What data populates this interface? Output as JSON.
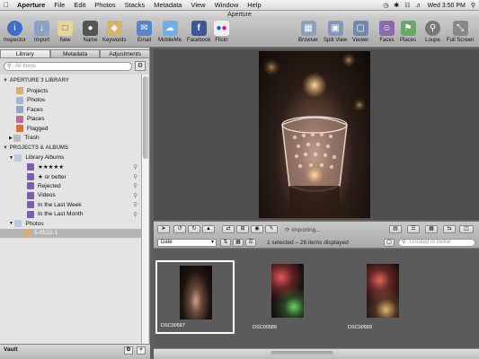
{
  "menubar": {
    "apple_icon": "apple-logo-icon",
    "items": [
      "Aperture",
      "File",
      "Edit",
      "Photos",
      "Stacks",
      "Metadata",
      "View",
      "Window",
      "Help"
    ],
    "clock": "Wed 3:50 PM"
  },
  "window": {
    "title": "Aperture"
  },
  "toolbar": {
    "inspector": "Inspector",
    "import": "Import",
    "new": "New",
    "name": "Name",
    "keywords": "Keywords",
    "email": "Email",
    "mobileme": "MobileMe",
    "facebook": "Facebook",
    "flickr": "Flickr",
    "browser": "Browser",
    "split_view": "Split View",
    "viewer": "Viewer",
    "faces": "Faces",
    "places": "Places",
    "loupe": "Loupe",
    "full_screen": "Full Screen"
  },
  "sidebar": {
    "tabs": [
      "Library",
      "Metadata",
      "Adjustments"
    ],
    "search_placeholder": "All Items",
    "library_header": "APERTURE 3 LIBRARY",
    "library_items": [
      "Projects",
      "Photos",
      "Faces",
      "Places",
      "Flagged",
      "Trash"
    ],
    "projects_header": "PROJECTS & ALBUMS",
    "albums_folder": "Library Albums",
    "album_items": [
      "★★★★★",
      "★ or better",
      "Rejected",
      "Videos",
      "In the Last Week",
      "In the Last Month"
    ],
    "photos_folder": "Photos",
    "selected_project": "5-0522-1",
    "vault_label": "Vault"
  },
  "controlbar": {
    "importing": "Importing...",
    "sort_value": "Date",
    "status_text": "1 selected – 26 items displayed",
    "filter_placeholder": "Unrated or Better"
  },
  "browser": {
    "items": [
      {
        "name": "DSC00587",
        "selected": true
      },
      {
        "name": "DSC00588",
        "selected": false
      },
      {
        "name": "DSC00589",
        "selected": false
      }
    ]
  },
  "colors": {
    "selection": "#b4b4b4",
    "viewer_bg": "#4e4e4e",
    "browser_bg": "#5b5b5b"
  }
}
